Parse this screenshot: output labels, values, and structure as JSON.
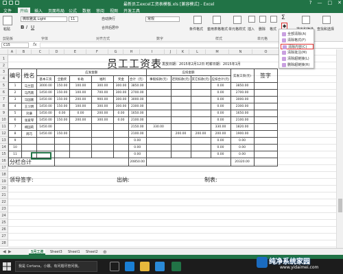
{
  "window": {
    "title": "最新员工excel工资表模板.xls [兼容模式] - Excel",
    "controls": [
      "?",
      "—",
      "□",
      "✕"
    ]
  },
  "ribbon_tabs": [
    "文件",
    "开始",
    "插入",
    "页面布局",
    "公式",
    "数据",
    "审阅",
    "视图",
    "开发工具"
  ],
  "ribbon": {
    "font_name": "微软雅黑 Light",
    "font_size": "11",
    "paste_label": "粘贴",
    "clipboard_label": "剪贴板",
    "font_label": "字体",
    "align_label": "对齐方式",
    "wrap_label": "自动换行",
    "merge_label": "合并后居中",
    "number_format": "常规",
    "number_label": "数字",
    "cond_format": "条件格式",
    "table_format": "套用表格格式",
    "cell_style": "单元格样式",
    "style_label": "样式",
    "insert": "插入",
    "delete": "删除",
    "format": "格式",
    "cells_label": "单元格",
    "sort_filter": "排序和筛选",
    "find_select": "查找和选择"
  },
  "formula_bar": {
    "name_box": "C15",
    "fx": "fx",
    "value": ""
  },
  "columns": [
    "A",
    "B",
    "C",
    "D",
    "E",
    "F",
    "G",
    "H",
    "I",
    "J",
    "K",
    "L",
    "M",
    "N",
    "O"
  ],
  "rows": [
    "1",
    "2",
    "3",
    "4",
    "5",
    "6",
    "7",
    "8",
    "9",
    "10",
    "11",
    "12",
    "13",
    "14",
    "15",
    "16",
    "17",
    "18",
    "19",
    "20",
    "21",
    "22",
    "23",
    "24",
    "25",
    "26",
    "27",
    "28"
  ],
  "sheet": {
    "title": "员工工资表",
    "subtitle": "发放日期：2015年2月12日 时薪日期：2015年1月",
    "group_should": "应发金额",
    "group_deduct": "应扣金额",
    "headers": {
      "no": "编号",
      "name": "姓名",
      "base": "基本工资",
      "attendance": "全勤奖",
      "subsidy": "补助",
      "welfare": "福利",
      "bonus": "奖金",
      "total": "合计（元）",
      "deduct_fee": "事假扣款(元)",
      "late_fee": "迟到扣款(元)",
      "other_fee": "其它扣款(元)",
      "deduct_total": "应扣合计(元)",
      "actual": "实发工资(元)",
      "sign": "签字"
    },
    "data_rows": [
      {
        "no": "1",
        "name": "马兰田",
        "base": "3000.00",
        "att": "150.00",
        "sub": "100.00",
        "wel": "300.00",
        "bonus": "300.00",
        "total": "3850.00",
        "d1": "",
        "d2": "",
        "d3": "",
        "dt": "0.00",
        "actual": "3850.00"
      },
      {
        "no": "2",
        "name": "马丙南",
        "base": "1450.00",
        "att": "150.00",
        "sub": "100.00",
        "wel": "700.00",
        "bonus": "300.00",
        "total": "2700.00",
        "d1": "",
        "d2": "",
        "d3": "",
        "dt": "0.00",
        "actual": "2700.00"
      },
      {
        "no": "3",
        "name": "马国嘉",
        "base": "1450.00",
        "att": "150.00",
        "sub": "200.00",
        "wel": "900.00",
        "bonus": "300.00",
        "total": "3000.00",
        "d1": "",
        "d2": "",
        "d3": "",
        "dt": "0.00",
        "actual": "3000.00"
      },
      {
        "no": "4",
        "name": "王习明",
        "base": "1450.00",
        "att": "150.00",
        "sub": "100.00",
        "wel": "300.00",
        "bonus": "300.00",
        "total": "2300.00",
        "d1": "",
        "d2": "",
        "d3": "",
        "dt": "0.00",
        "actual": "2300.00"
      },
      {
        "no": "5",
        "name": "刘谦",
        "base": "1450.00",
        "att": "0.00",
        "sub": "0.00",
        "wel": "200.00",
        "bonus": "0.00",
        "total": "1650.00",
        "d1": "",
        "d2": "",
        "d3": "",
        "dt": "0.00",
        "actual": "1650.00"
      },
      {
        "no": "6",
        "name": "张爱琴",
        "base": "1450.00",
        "att": "150.00",
        "sub": "200.00",
        "wel": "300.00",
        "bonus": "0.00",
        "total": "2100.00",
        "d1": "",
        "d2": "",
        "d3": "",
        "dt": "0.00",
        "actual": "2100.00"
      },
      {
        "no": "7",
        "name": "胡国莉",
        "base": "1450.00",
        "att": "",
        "sub": "",
        "wel": "",
        "bonus": "",
        "total": "2150.00",
        "d1": "330.00",
        "d2": "",
        "d3": "",
        "dt": "330.00",
        "actual": "1820.00"
      },
      {
        "no": "8",
        "name": "周巧",
        "base": "1450.00",
        "att": "150.00",
        "sub": "",
        "wel": "",
        "bonus": "",
        "total": "2100.00",
        "d1": "",
        "d2": "200.00",
        "d3": "200.00",
        "dt": "200.00",
        "actual": "1900.00"
      },
      {
        "no": "9",
        "name": "",
        "base": "",
        "att": "",
        "sub": "",
        "wel": "",
        "bonus": "",
        "total": "0.00",
        "d1": "",
        "d2": "",
        "d3": "",
        "dt": "0.00",
        "actual": "0.00"
      },
      {
        "no": "10",
        "name": "",
        "base": "",
        "att": "",
        "sub": "",
        "wel": "",
        "bonus": "",
        "total": "0.00",
        "d1": "",
        "d2": "",
        "d3": "",
        "dt": "0.00",
        "actual": "0.00"
      },
      {
        "no": "11",
        "name": "",
        "base": "",
        "att": "",
        "sub": "",
        "wel": "",
        "bonus": "",
        "total": "0.00",
        "d1": "",
        "d2": "",
        "d3": "",
        "dt": "0.00",
        "actual": "0.00"
      }
    ],
    "subtotal_label": "分栏合计",
    "subtotal_total": "20850.00",
    "subtotal_actual": "20320.00",
    "sign_leader": "领导签字:",
    "sign_cashier": "出纳:",
    "sign_maker": "制表:"
  },
  "clear_menu": {
    "items": [
      "全部清除(A)",
      "清除格式(F)",
      "清除内容(C)",
      "清除批注(M)",
      "清除超链接(L)",
      "删除超链接(R)"
    ],
    "highlighted_index": 2
  },
  "sheet_tabs": [
    "5月工资",
    "Sheet3",
    "Sheet1",
    "Sheet2"
  ],
  "active_sheet_tab": "5月工资",
  "taskbar": {
    "search_text": "我是 Cortana，小娜。有问题尽管问我。"
  },
  "watermark": {
    "text": "纯净系统家园",
    "url": "www.yidaimei.com"
  },
  "colors": {
    "excel_green": "#217346",
    "highlight_red": "#e03030"
  }
}
